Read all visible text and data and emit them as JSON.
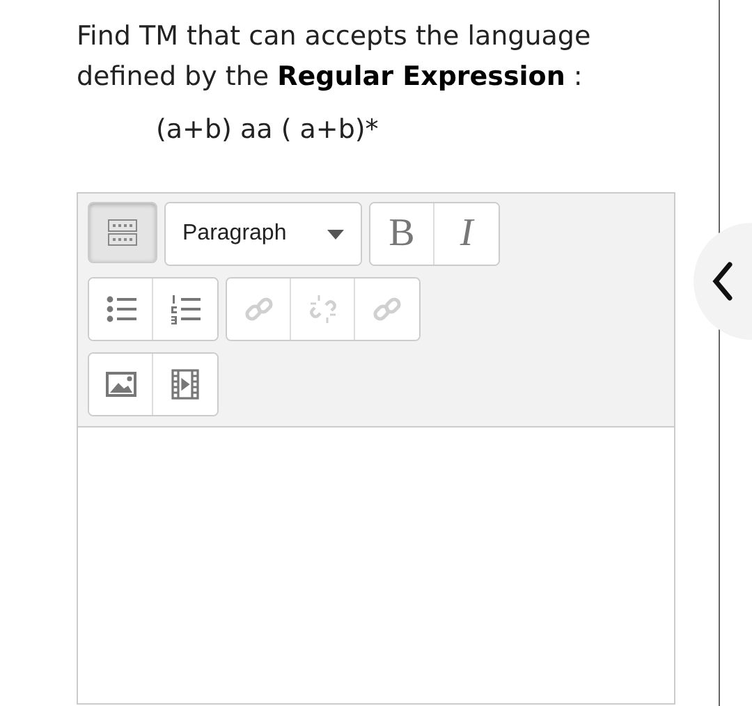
{
  "question": {
    "text": "Find TM that can accepts the language defined by the **Regular Expression** :",
    "expression": "(a+b) aa ( a+b)*"
  },
  "editor": {
    "toolbar_toggle": {
      "pressed": true
    },
    "format_select": {
      "value": "Paragraph"
    },
    "toolbar_rows": [
      [
        [
          {
            "kind": "select"
          }
        ],
        [
          {
            "kind": "bold",
            "label": "B",
            "disabled": false
          },
          {
            "kind": "italic",
            "label": "I",
            "disabled": false
          }
        ]
      ],
      [
        [
          {
            "kind": "bullet-list",
            "disabled": false
          },
          {
            "kind": "numbered-list",
            "disabled": false
          }
        ],
        [
          {
            "kind": "link",
            "disabled": true
          },
          {
            "kind": "unlink",
            "disabled": true
          },
          {
            "kind": "link",
            "disabled": true
          }
        ]
      ],
      [
        [
          {
            "kind": "image",
            "disabled": false
          },
          {
            "kind": "video",
            "disabled": false
          }
        ]
      ]
    ]
  }
}
